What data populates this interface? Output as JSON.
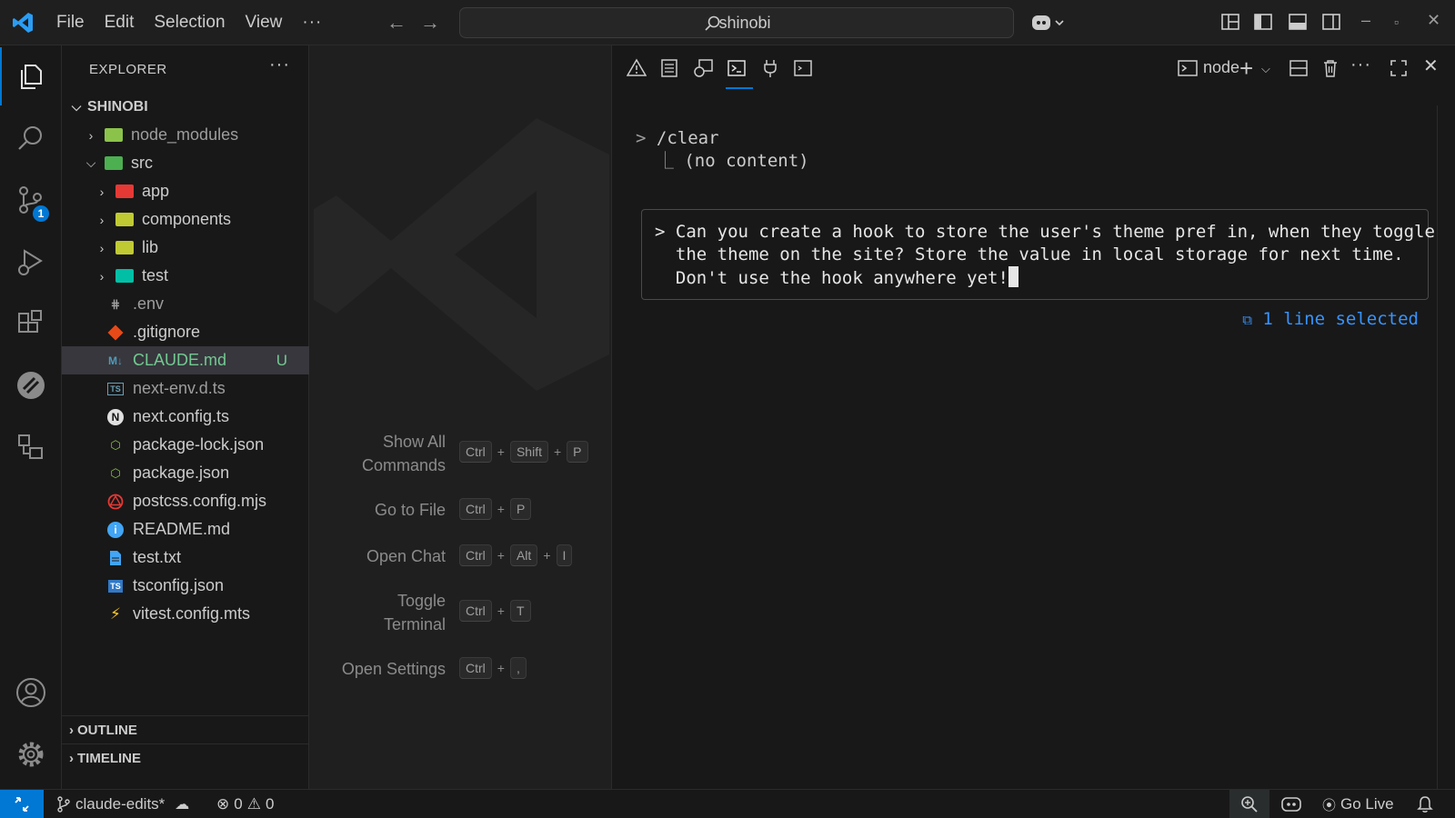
{
  "titlebar": {
    "menus": [
      "File",
      "Edit",
      "Selection",
      "View"
    ],
    "more_label": "···",
    "search_text": "shinobi"
  },
  "activity": {
    "items": [
      "explorer-icon",
      "search-icon",
      "source-control-icon",
      "run-debug-icon",
      "extensions-icon",
      "remote-explorer-icon",
      "testing-icon"
    ],
    "source_control_badge": "1"
  },
  "explorer": {
    "title": "EXPLORER",
    "more_label": "···",
    "root": "SHINOBI",
    "items": [
      {
        "label": "node_modules",
        "kind": "folder",
        "color": "#8bc34a"
      },
      {
        "label": "src",
        "kind": "folder",
        "color": "#4caf50"
      },
      {
        "label": "app",
        "kind": "folder",
        "color": "#e53935"
      },
      {
        "label": "components",
        "kind": "folder",
        "color": "#c0ca33"
      },
      {
        "label": "lib",
        "kind": "folder",
        "color": "#c0ca33"
      },
      {
        "label": "test",
        "kind": "folder",
        "color": "#00bfa5"
      },
      {
        "label": ".env",
        "kind": "file"
      },
      {
        "label": ".gitignore",
        "kind": "file"
      },
      {
        "label": "CLAUDE.md",
        "kind": "file",
        "git_status": "U"
      },
      {
        "label": "next-env.d.ts",
        "kind": "file"
      },
      {
        "label": "next.config.ts",
        "kind": "file"
      },
      {
        "label": "package-lock.json",
        "kind": "file"
      },
      {
        "label": "package.json",
        "kind": "file"
      },
      {
        "label": "postcss.config.mjs",
        "kind": "file"
      },
      {
        "label": "README.md",
        "kind": "file"
      },
      {
        "label": "test.txt",
        "kind": "file"
      },
      {
        "label": "tsconfig.json",
        "kind": "file"
      },
      {
        "label": "vitest.config.mts",
        "kind": "file"
      }
    ],
    "outline": "OUTLINE",
    "timeline": "TIMELINE"
  },
  "editor": {
    "shortcuts": [
      {
        "label": "Show All\nCommands",
        "keys": [
          "Ctrl",
          "Shift",
          "P"
        ]
      },
      {
        "label": "Go to File",
        "keys": [
          "Ctrl",
          "P"
        ]
      },
      {
        "label": "Open Chat",
        "keys": [
          "Ctrl",
          "Alt",
          "I"
        ]
      },
      {
        "label": "Toggle\nTerminal",
        "keys": [
          "Ctrl",
          "T"
        ]
      },
      {
        "label": "Open Settings",
        "keys": [
          "Ctrl",
          ","
        ]
      }
    ]
  },
  "terminal": {
    "name": "node",
    "history_command": "/clear",
    "history_output": "(no content)",
    "prompt_lines": [
      "Can you create a hook to store the user's theme pref in, when they toggle",
      "the theme on the site? Store the value in local storage for next time.",
      "Don't use the hook anywhere yet!"
    ],
    "selection_info": "1 line selected"
  },
  "statusbar": {
    "branch": "claude-edits*",
    "errors": "0",
    "warnings": "0",
    "go_live": "Go Live"
  }
}
